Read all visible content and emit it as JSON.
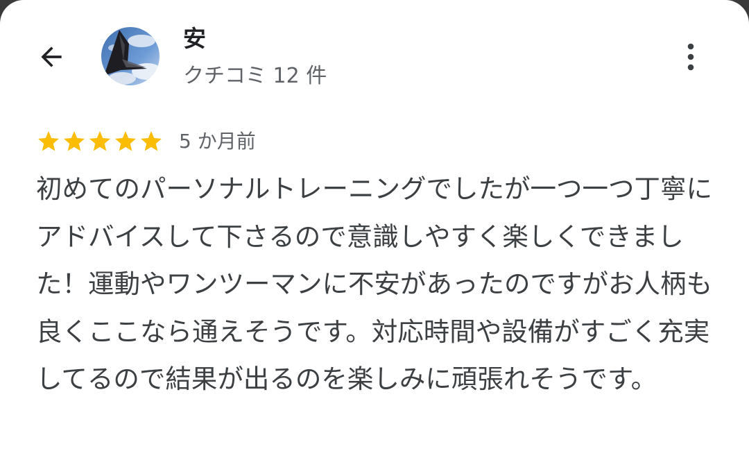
{
  "reviewer": {
    "name": "安",
    "review_count": "クチコミ 12 件"
  },
  "review": {
    "rating": 5,
    "max_rating": 5,
    "time_ago": "5 か月前",
    "text": "初めてのパーソナルトレーニングでしたが一つ一つ丁寧にアドバイスして下さるので意識しやすく楽しくできました！運動やワンツーマンに不安があったのですがお人柄も良くここなら通えそうです。対応時間や設備がすごく充実してるので結果が出るのを楽しみに頑張れそうです。"
  },
  "icons": {
    "back": "arrow-back-icon",
    "more": "more-vert-icon",
    "star": "star-icon"
  },
  "colors": {
    "star": "#FBBC04",
    "text": "#3c4043",
    "secondary_text": "#5f6368"
  }
}
